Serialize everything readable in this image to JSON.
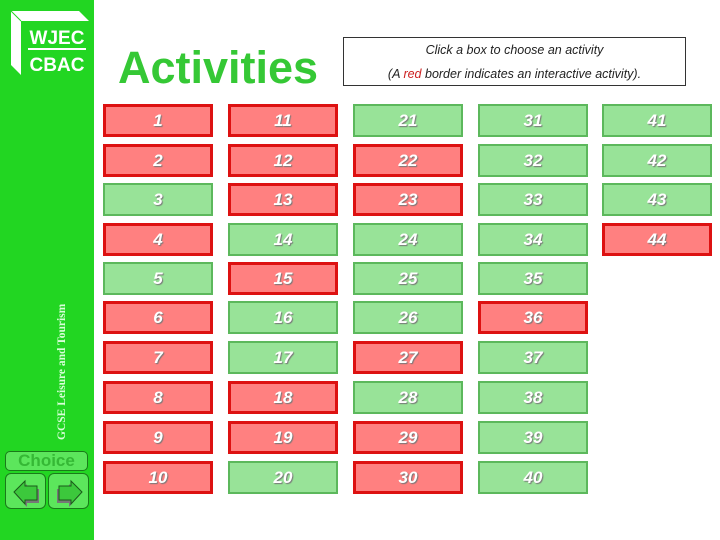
{
  "logo": {
    "line1": "WJEC",
    "line2": "CBAC"
  },
  "sidebar": {
    "vertical_label": "GCSE Leisure and Tourism",
    "choice_label": "Choice",
    "prev_icon": "arrow-left-icon",
    "next_icon": "arrow-right-icon"
  },
  "header": {
    "title": "Activities",
    "instructions": {
      "line1": "Click a box to choose an activity",
      "line2_prefix": "(A ",
      "line2_red": "red",
      "line2_suffix": " border indicates an interactive activity)."
    }
  },
  "colors": {
    "sidebar": "#22d622",
    "interactive_fill": "#ff8080",
    "interactive_border": "#dd1111",
    "normal_fill": "#98e398",
    "normal_border": "#5cb85c",
    "title": "#35c835"
  },
  "activities": [
    {
      "label": "1",
      "interactive": true
    },
    {
      "label": "2",
      "interactive": true
    },
    {
      "label": "3",
      "interactive": false
    },
    {
      "label": "4",
      "interactive": true
    },
    {
      "label": "5",
      "interactive": false
    },
    {
      "label": "6",
      "interactive": true
    },
    {
      "label": "7",
      "interactive": true
    },
    {
      "label": "8",
      "interactive": true
    },
    {
      "label": "9",
      "interactive": true
    },
    {
      "label": "10",
      "interactive": true
    },
    {
      "label": "11",
      "interactive": true
    },
    {
      "label": "12",
      "interactive": true
    },
    {
      "label": "13",
      "interactive": true
    },
    {
      "label": "14",
      "interactive": false
    },
    {
      "label": "15",
      "interactive": true
    },
    {
      "label": "16",
      "interactive": false
    },
    {
      "label": "17",
      "interactive": false
    },
    {
      "label": "18",
      "interactive": true
    },
    {
      "label": "19",
      "interactive": true
    },
    {
      "label": "20",
      "interactive": false
    },
    {
      "label": "21",
      "interactive": false
    },
    {
      "label": "22",
      "interactive": true
    },
    {
      "label": "23",
      "interactive": true
    },
    {
      "label": "24",
      "interactive": false
    },
    {
      "label": "25",
      "interactive": false
    },
    {
      "label": "26",
      "interactive": false
    },
    {
      "label": "27",
      "interactive": true
    },
    {
      "label": "28",
      "interactive": false
    },
    {
      "label": "29",
      "interactive": true
    },
    {
      "label": "30",
      "interactive": true
    },
    {
      "label": "31",
      "interactive": false
    },
    {
      "label": "32",
      "interactive": false
    },
    {
      "label": "33",
      "interactive": false
    },
    {
      "label": "34",
      "interactive": false
    },
    {
      "label": "35",
      "interactive": false
    },
    {
      "label": "36",
      "interactive": true
    },
    {
      "label": "37",
      "interactive": false
    },
    {
      "label": "38",
      "interactive": false
    },
    {
      "label": "39",
      "interactive": false
    },
    {
      "label": "40",
      "interactive": false
    },
    {
      "label": "41",
      "interactive": false
    },
    {
      "label": "42",
      "interactive": false
    },
    {
      "label": "43",
      "interactive": false
    },
    {
      "label": "44",
      "interactive": true
    }
  ]
}
